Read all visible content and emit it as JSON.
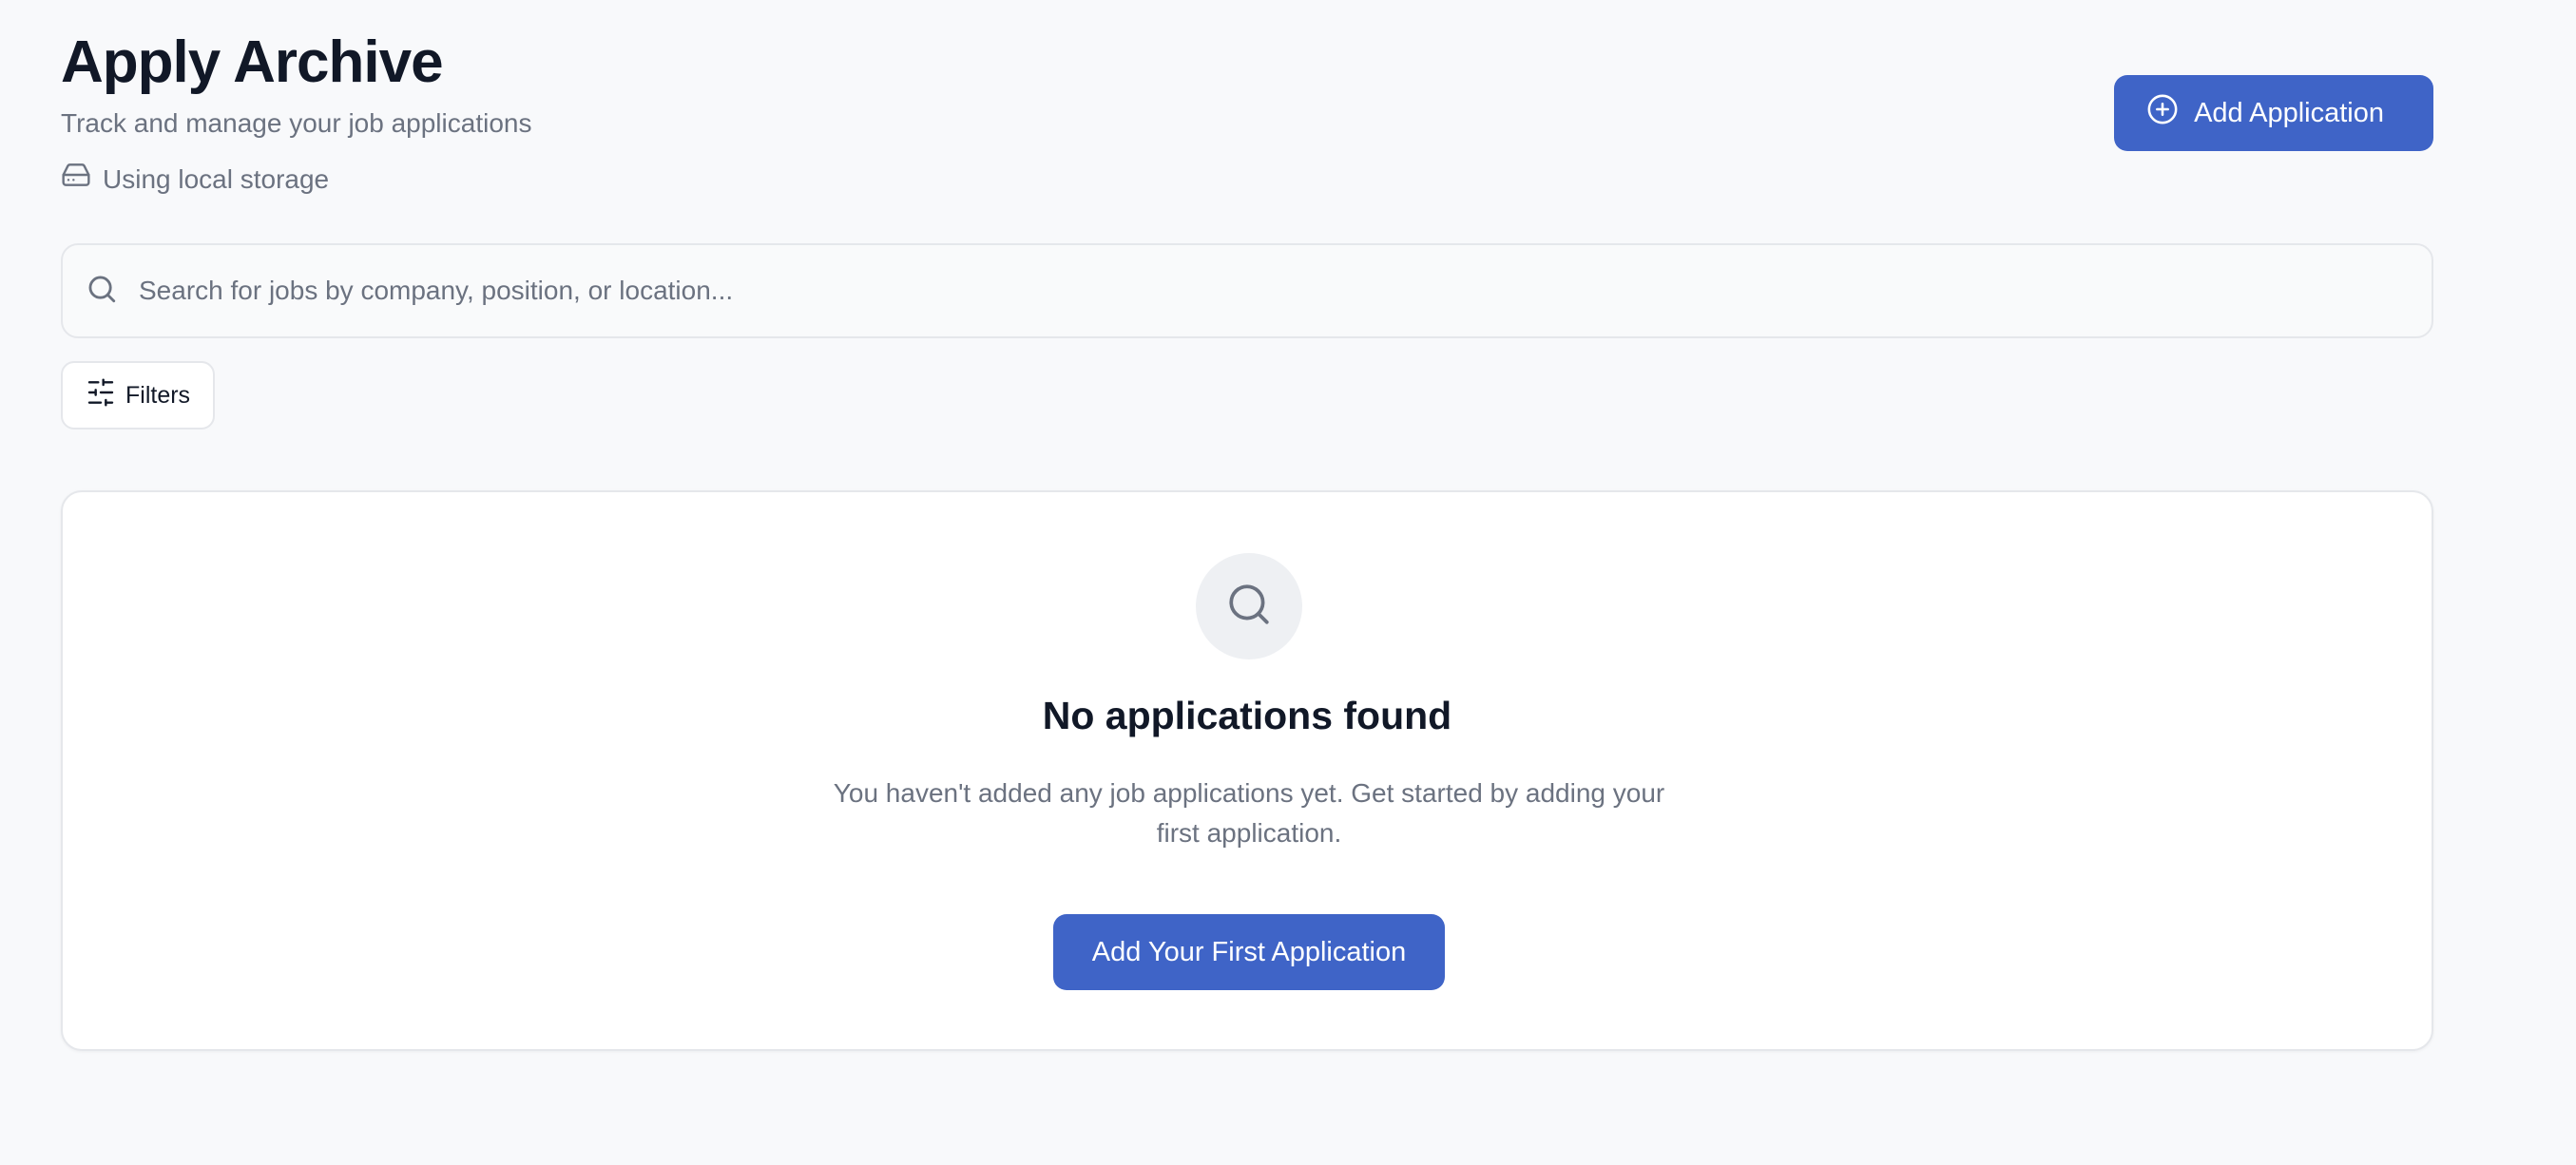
{
  "header": {
    "title": "Apply Archive",
    "subtitle": "Track and manage your job applications",
    "storage_label": "Using local storage",
    "storage_icon": "hard-drive-icon",
    "add_button_label": "Add Application",
    "add_button_icon": "plus-circle-icon"
  },
  "search": {
    "placeholder": "Search for jobs by company, position, or location...",
    "value": "",
    "icon": "search-icon"
  },
  "filters": {
    "label": "Filters",
    "icon": "sliders-icon"
  },
  "empty_state": {
    "icon": "search-icon",
    "title": "No applications found",
    "description": "You haven't added any job applications yet. Get started by adding your first application.",
    "button_label": "Add Your First Application"
  },
  "colors": {
    "accent": "#3f64c7",
    "background": "#f8f9fb",
    "muted_text": "#6b7280",
    "border": "#e5e7eb"
  }
}
